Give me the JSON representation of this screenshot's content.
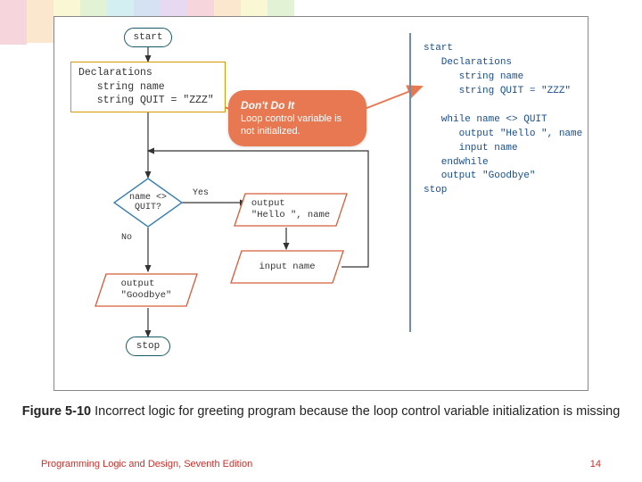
{
  "figure": {
    "number": "Figure 5-10",
    "title_rest": " Incorrect logic for greeting program because the loop control variable initialization is missing"
  },
  "footer": {
    "left": "Programming Logic and Design, Seventh Edition",
    "right": "14"
  },
  "flow": {
    "start": "start",
    "stop": "stop",
    "declarations": "Declarations\n   string name\n   string QUIT = \"ZZZ\"",
    "decision": "name <>\nQUIT?",
    "yes": "Yes",
    "no": "No",
    "out_hello": "output\n\"Hello \", name",
    "input_name": "input name",
    "out_goodbye": "output\n\"Goodbye\""
  },
  "callout": {
    "heading": "Don't Do It",
    "body": "Loop control variable is not initialized."
  },
  "pseudocode": "start\n   Declarations\n      string name\n      string QUIT = \"ZZZ\"\n\n   while name <> QUIT\n      output \"Hello \", name\n      input name\n   endwhile\n   output \"Goodbye\"\nstop",
  "colors": {
    "orange": "#e87852",
    "term_border": "#1a5a66",
    "decl_border": "#d59a00",
    "para_stroke": "#d35d3a",
    "diamond_stroke": "#3a7fae",
    "divider": "#6a8fa8",
    "footer": "#c9302c",
    "pseudocode": "#1a4d8c"
  },
  "chart_data": {
    "type": "flowchart",
    "nodes": [
      {
        "id": "start",
        "kind": "terminal",
        "text": "start"
      },
      {
        "id": "decl",
        "kind": "process",
        "text": "Declarations\n   string name\n   string QUIT = \"ZZZ\""
      },
      {
        "id": "cond",
        "kind": "decision",
        "text": "name <> QUIT?"
      },
      {
        "id": "out_hello",
        "kind": "io",
        "text": "output \"Hello \", name"
      },
      {
        "id": "input_name",
        "kind": "io",
        "text": "input name"
      },
      {
        "id": "out_goodbye",
        "kind": "io",
        "text": "output \"Goodbye\""
      },
      {
        "id": "stop",
        "kind": "terminal",
        "text": "stop"
      }
    ],
    "edges": [
      {
        "from": "start",
        "to": "decl"
      },
      {
        "from": "decl",
        "to": "cond"
      },
      {
        "from": "cond",
        "to": "out_hello",
        "label": "Yes"
      },
      {
        "from": "out_hello",
        "to": "input_name"
      },
      {
        "from": "input_name",
        "to": "cond",
        "loop_back": true
      },
      {
        "from": "cond",
        "to": "out_goodbye",
        "label": "No"
      },
      {
        "from": "out_goodbye",
        "to": "stop"
      }
    ],
    "annotation": {
      "text": "Don't Do It — Loop control variable is not initialized.",
      "points_to": "decl"
    }
  }
}
